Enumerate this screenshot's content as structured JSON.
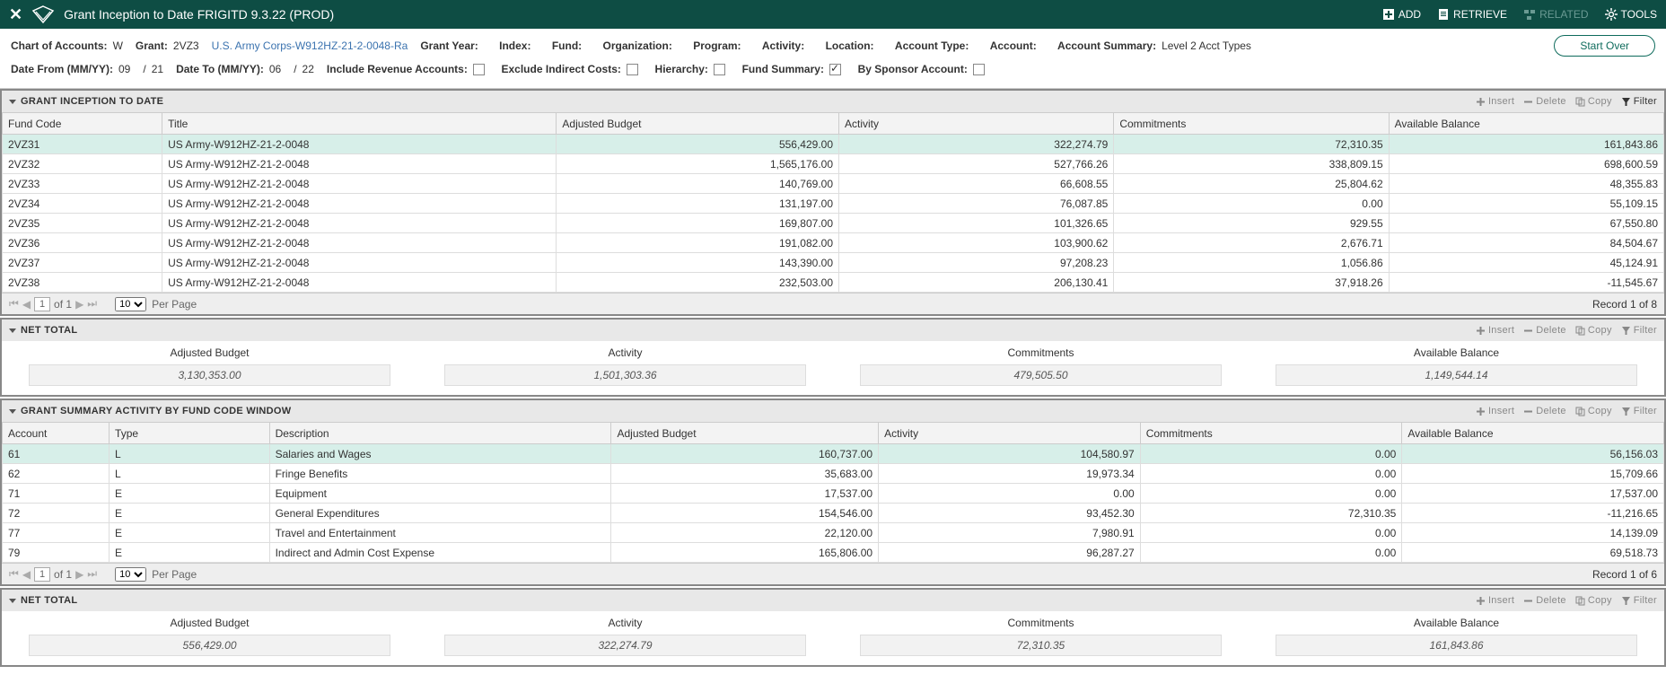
{
  "header": {
    "title": "Grant Inception to Date FRIGITD 9.3.22 (PROD)",
    "add": "ADD",
    "retrieve": "RETRIEVE",
    "related": "RELATED",
    "tools": "TOOLS"
  },
  "keyblock": {
    "chart_label": "Chart of Accounts:",
    "chart_val": "W",
    "grant_label": "Grant:",
    "grant_val": "2VZ3",
    "grant_link": "U.S. Army Corps-W912HZ-21-2-0048-Ra",
    "grant_year_label": "Grant Year:",
    "index_label": "Index:",
    "fund_label": "Fund:",
    "org_label": "Organization:",
    "program_label": "Program:",
    "activity_label": "Activity:",
    "location_label": "Location:",
    "acct_type_label": "Account Type:",
    "account_label": "Account:",
    "acct_summary_label": "Account Summary:",
    "acct_summary_val": "Level 2 Acct Types",
    "date_from_label": "Date From (MM/YY):",
    "date_from_mm": "09",
    "date_from_yy": "21",
    "date_to_label": "Date To (MM/YY):",
    "date_to_mm": "06",
    "date_to_yy": "22",
    "include_rev_label": "Include Revenue Accounts:",
    "exclude_indirect_label": "Exclude Indirect Costs:",
    "hierarchy_label": "Hierarchy:",
    "fund_summary_label": "Fund Summary:",
    "by_sponsor_label": "By Sponsor Account:",
    "start_over": "Start Over"
  },
  "sections": {
    "s1_title": "GRANT INCEPTION TO DATE",
    "s2_title": "NET TOTAL",
    "s3_title": "GRANT SUMMARY ACTIVITY BY FUND CODE WINDOW",
    "s4_title": "NET TOTAL",
    "insert": "Insert",
    "delete": "Delete",
    "copy": "Copy",
    "filter": "Filter"
  },
  "grid1": {
    "headers": {
      "fund": "Fund Code",
      "title": "Title",
      "budget": "Adjusted Budget",
      "activity": "Activity",
      "commit": "Commitments",
      "avail": "Available Balance"
    },
    "rows": [
      {
        "fund": "2VZ31",
        "title": "US Army-W912HZ-21-2-0048",
        "budget": "556,429.00",
        "activity": "322,274.79",
        "commit": "72,310.35",
        "avail": "161,843.86"
      },
      {
        "fund": "2VZ32",
        "title": "US Army-W912HZ-21-2-0048",
        "budget": "1,565,176.00",
        "activity": "527,766.26",
        "commit": "338,809.15",
        "avail": "698,600.59"
      },
      {
        "fund": "2VZ33",
        "title": "US Army-W912HZ-21-2-0048",
        "budget": "140,769.00",
        "activity": "66,608.55",
        "commit": "25,804.62",
        "avail": "48,355.83"
      },
      {
        "fund": "2VZ34",
        "title": "US Army-W912HZ-21-2-0048",
        "budget": "131,197.00",
        "activity": "76,087.85",
        "commit": "0.00",
        "avail": "55,109.15"
      },
      {
        "fund": "2VZ35",
        "title": "US Army-W912HZ-21-2-0048",
        "budget": "169,807.00",
        "activity": "101,326.65",
        "commit": "929.55",
        "avail": "67,550.80"
      },
      {
        "fund": "2VZ36",
        "title": "US Army-W912HZ-21-2-0048",
        "budget": "191,082.00",
        "activity": "103,900.62",
        "commit": "2,676.71",
        "avail": "84,504.67"
      },
      {
        "fund": "2VZ37",
        "title": "US Army-W912HZ-21-2-0048",
        "budget": "143,390.00",
        "activity": "97,208.23",
        "commit": "1,056.86",
        "avail": "45,124.91"
      },
      {
        "fund": "2VZ38",
        "title": "US Army-W912HZ-21-2-0048",
        "budget": "232,503.00",
        "activity": "206,130.41",
        "commit": "37,918.26",
        "avail": "-11,545.67"
      }
    ],
    "per_page": "Per Page",
    "of": "of 1",
    "page": "1",
    "rows_sel": "10",
    "record": "Record 1 of 8"
  },
  "net1": {
    "budget_label": "Adjusted Budget",
    "budget_val": "3,130,353.00",
    "activity_label": "Activity",
    "activity_val": "1,501,303.36",
    "commit_label": "Commitments",
    "commit_val": "479,505.50",
    "avail_label": "Available Balance",
    "avail_val": "1,149,544.14"
  },
  "grid2": {
    "headers": {
      "acct": "Account",
      "type": "Type",
      "desc": "Description",
      "budget": "Adjusted Budget",
      "activity": "Activity",
      "commit": "Commitments",
      "avail": "Available Balance"
    },
    "rows": [
      {
        "acct": "61",
        "type": "L",
        "desc": "Salaries and Wages",
        "budget": "160,737.00",
        "activity": "104,580.97",
        "commit": "0.00",
        "avail": "56,156.03"
      },
      {
        "acct": "62",
        "type": "L",
        "desc": "Fringe Benefits",
        "budget": "35,683.00",
        "activity": "19,973.34",
        "commit": "0.00",
        "avail": "15,709.66"
      },
      {
        "acct": "71",
        "type": "E",
        "desc": "Equipment",
        "budget": "17,537.00",
        "activity": "0.00",
        "commit": "0.00",
        "avail": "17,537.00"
      },
      {
        "acct": "72",
        "type": "E",
        "desc": "General Expenditures",
        "budget": "154,546.00",
        "activity": "93,452.30",
        "commit": "72,310.35",
        "avail": "-11,216.65"
      },
      {
        "acct": "77",
        "type": "E",
        "desc": "Travel and Entertainment",
        "budget": "22,120.00",
        "activity": "7,980.91",
        "commit": "0.00",
        "avail": "14,139.09"
      },
      {
        "acct": "79",
        "type": "E",
        "desc": "Indirect and Admin Cost Expense",
        "budget": "165,806.00",
        "activity": "96,287.27",
        "commit": "0.00",
        "avail": "69,518.73"
      }
    ],
    "per_page": "Per Page",
    "of": "of 1",
    "page": "1",
    "rows_sel": "10",
    "record": "Record 1 of 6"
  },
  "net2": {
    "budget_label": "Adjusted Budget",
    "budget_val": "556,429.00",
    "activity_label": "Activity",
    "activity_val": "322,274.79",
    "commit_label": "Commitments",
    "commit_val": "72,310.35",
    "avail_label": "Available Balance",
    "avail_val": "161,843.86"
  }
}
